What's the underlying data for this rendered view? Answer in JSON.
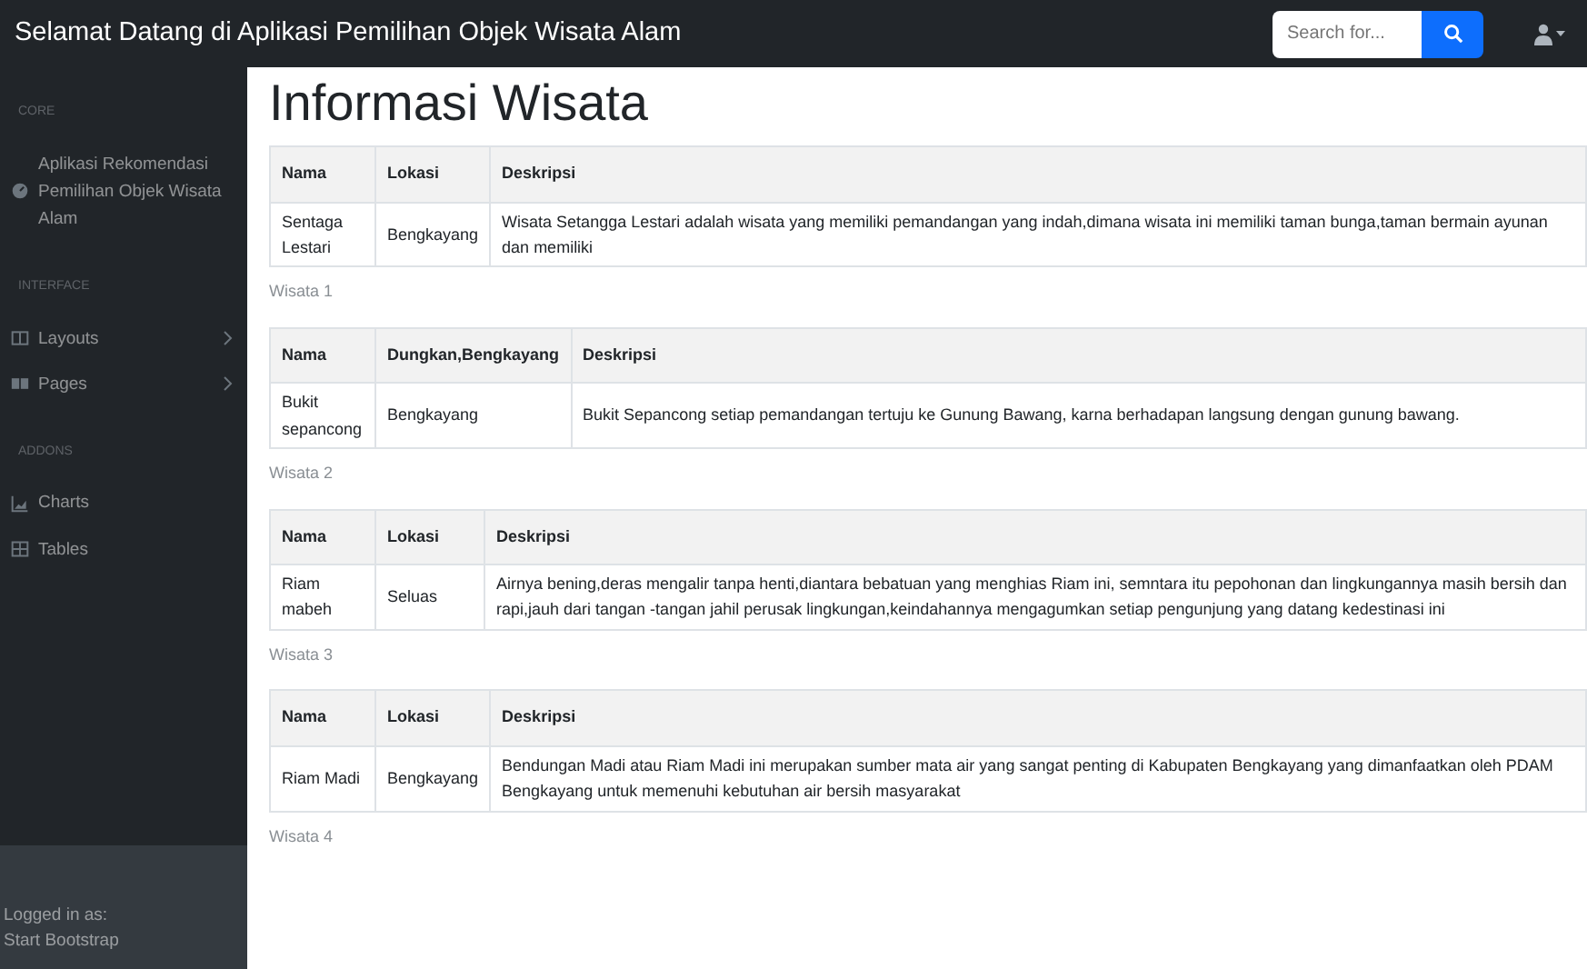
{
  "navbar": {
    "brand": "Selamat Datang di Aplikasi Pemilihan Objek Wisata Alam",
    "search": {
      "placeholder": "Search for..."
    }
  },
  "sidebar": {
    "sections": [
      {
        "heading": "CORE",
        "items": [
          {
            "label": "Aplikasi Rekomendasi Pemilihan Objek Wisata Alam",
            "kind": "gauge",
            "expandable": false
          }
        ]
      },
      {
        "heading": "INTERFACE",
        "items": [
          {
            "label": "Layouts",
            "kind": "columns",
            "expandable": true
          },
          {
            "label": "Pages",
            "kind": "book",
            "expandable": true
          }
        ]
      },
      {
        "heading": "ADDONS",
        "items": [
          {
            "label": "Charts",
            "kind": "chart",
            "expandable": false
          },
          {
            "label": "Tables",
            "kind": "table",
            "expandable": false
          }
        ]
      }
    ],
    "footer": {
      "label": "Logged in as:",
      "user": "Start Bootstrap"
    }
  },
  "main": {
    "title": "Informasi Wisata",
    "tables": [
      {
        "columns": [
          "Nama",
          "Lokasi",
          "Deskripsi"
        ],
        "rows": [
          [
            "Sentaga Lestari",
            "Bengkayang",
            "Wisata Setangga Lestari adalah wisata yang memiliki pemandangan yang indah,dimana wisata ini memiliki taman bunga,taman bermain ayunan dan memiliki"
          ]
        ],
        "caption": "Wisata 1"
      },
      {
        "columns": [
          "Nama",
          "Dungkan,Bengkayang",
          "Deskripsi"
        ],
        "rows": [
          [
            "Bukit sepancong",
            "Bengkayang",
            "Bukit Sepancong setiap pemandangan tertuju ke Gunung Bawang, karna berhadapan langsung dengan gunung bawang."
          ]
        ],
        "caption": "Wisata 2"
      },
      {
        "columns": [
          "Nama",
          "Lokasi",
          "Deskripsi"
        ],
        "rows": [
          [
            "Riam mabeh",
            "Seluas",
            "Airnya bening,deras mengalir tanpa henti,diantara bebatuan yang menghias Riam ini, semntara itu pepohonan dan lingkungannya masih bersih dan rapi,jauh dari tangan -tangan jahil perusak lingkungan,keindahannya mengagumkan setiap pengunjung yang datang kedestinasi ini"
          ]
        ],
        "caption": "Wisata 3"
      },
      {
        "columns": [
          "Nama",
          "Lokasi",
          "Deskripsi"
        ],
        "rows": [
          [
            "Riam Madi",
            "Bengkayang",
            "Bendungan Madi atau Riam Madi ini merupakan sumber mata air yang sangat penting di Kabupaten Bengkayang yang dimanfaatkan oleh PDAM Bengkayang untuk memenuhi kebutuhan air bersih masyarakat"
          ]
        ],
        "caption": "Wisata 4"
      }
    ]
  }
}
